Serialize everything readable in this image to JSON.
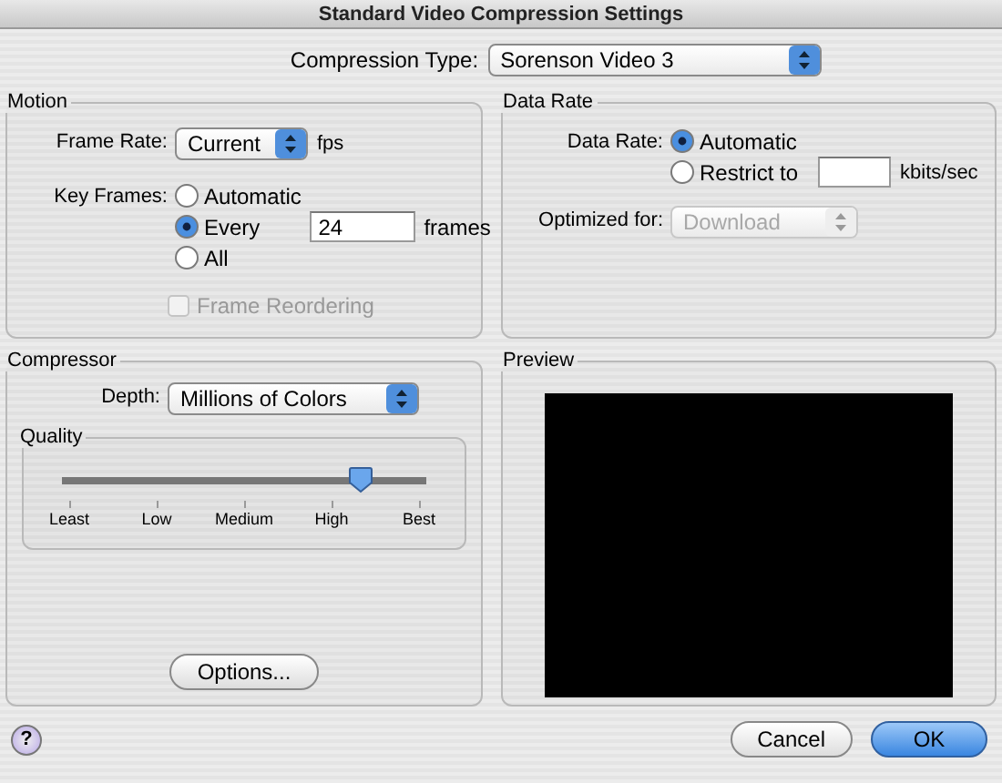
{
  "window": {
    "title": "Standard Video Compression Settings"
  },
  "compression_type": {
    "label": "Compression Type:",
    "value": "Sorenson Video 3"
  },
  "motion": {
    "title": "Motion",
    "frame_rate": {
      "label": "Frame Rate:",
      "value": "Current",
      "unit": "fps"
    },
    "key_frames": {
      "label": "Key Frames:",
      "options": [
        {
          "label": "Automatic",
          "selected": false
        },
        {
          "label": "Every",
          "selected": true
        },
        {
          "label": "All",
          "selected": false
        }
      ],
      "every_value": "24",
      "every_unit": "frames"
    },
    "frame_reordering": {
      "label": "Frame Reordering",
      "checked": false,
      "disabled": true
    }
  },
  "data_rate": {
    "title": "Data Rate",
    "label": "Data Rate:",
    "options": [
      {
        "label": "Automatic",
        "selected": true
      },
      {
        "label": "Restrict to",
        "selected": false
      }
    ],
    "limit_unit": "kbits/sec",
    "optimized_for": {
      "label": "Optimized for:",
      "value": "Download",
      "disabled": true
    }
  },
  "compressor": {
    "title": "Compressor",
    "depth": {
      "label": "Depth:",
      "value": "Millions of Colors"
    },
    "quality": {
      "title": "Quality",
      "level": 0.82,
      "ticks": [
        "Least",
        "Low",
        "Medium",
        "High",
        "Best"
      ]
    },
    "options_button": "Options..."
  },
  "preview": {
    "title": "Preview"
  },
  "help": "?",
  "buttons": [
    {
      "label": "Cancel",
      "kind": "normal"
    },
    {
      "label": "OK",
      "kind": "default"
    }
  ]
}
